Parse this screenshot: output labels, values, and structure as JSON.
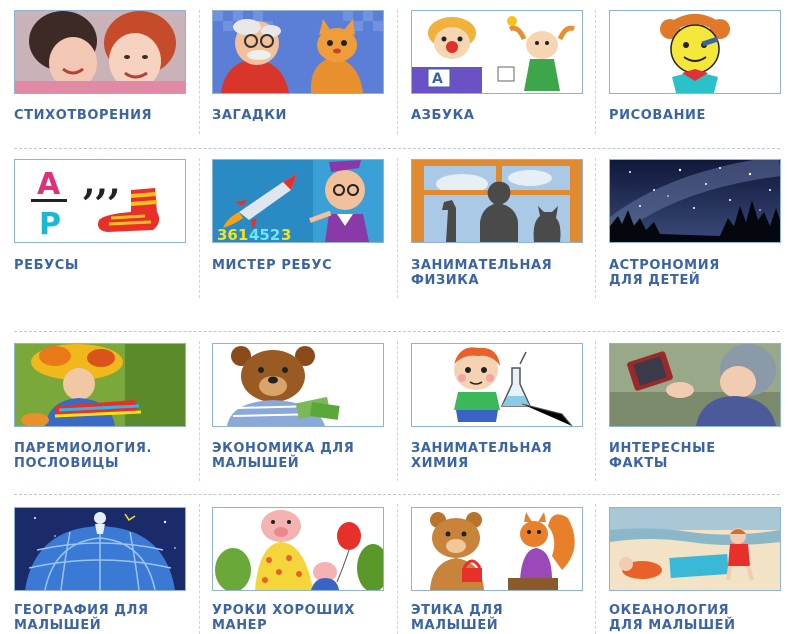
{
  "sections": [
    {
      "items": [
        {
          "id": "poems",
          "label": "СТИХОТВОРЕНИЯ",
          "icon": "children-photo-icon"
        },
        {
          "id": "riddles",
          "label": "ЗАГАДКИ",
          "icon": "grandpa-cat-icon"
        },
        {
          "id": "alphabet",
          "label": "АЗБУКА",
          "icon": "clown-alphabet-icon"
        },
        {
          "id": "drawing",
          "label": "РИСОВАНИЕ",
          "icon": "doll-drawing-icon"
        }
      ]
    },
    {
      "items": [
        {
          "id": "rebuses",
          "label": "РЕБУСЫ",
          "icon": "rebus-letters-sock-icon"
        },
        {
          "id": "mister-rebus",
          "label": "МИСТЕР РЕБУС",
          "icon": "rocket-teacher-icon"
        },
        {
          "id": "physics",
          "label": "ЗАНИМАТЕЛЬНАЯ\nФИЗИКА",
          "icon": "window-silhouettes-icon"
        },
        {
          "id": "astronomy",
          "label": "АСТРОНОМИЯ\nДЛЯ ДЕТЕЙ",
          "icon": "night-sky-icon"
        }
      ]
    },
    {
      "items": [
        {
          "id": "proverbs",
          "label": "ПАРЕМИОЛОГИЯ.\nПОСЛОВИЦЫ",
          "icon": "autumn-leaves-child-icon"
        },
        {
          "id": "economics",
          "label": "ЭКОНОМИКА ДЛЯ\nМАЛЫШЕЙ",
          "icon": "bear-money-icon"
        },
        {
          "id": "chemistry",
          "label": "ЗАНИМАТЕЛЬНАЯ\nХИМИЯ",
          "icon": "boy-flask-icon"
        },
        {
          "id": "facts",
          "label": "ИНТЕРЕСНЫЕ\nФАКТЫ",
          "icon": "child-tablet-icon"
        }
      ]
    },
    {
      "items": [
        {
          "id": "geography",
          "label": "ГЕОГРАФИЯ ДЛЯ\nМАЛЫШЕЙ",
          "icon": "globe-night-icon"
        },
        {
          "id": "manners",
          "label": "УРОКИ ХОРОШИХ\nМАНЕР",
          "icon": "pig-balloon-icon"
        },
        {
          "id": "ethics",
          "label": "ЭТИКА ДЛЯ\nМАЛЫШЕЙ",
          "icon": "bear-squirrel-icon"
        },
        {
          "id": "oceanology",
          "label": "ОКЕАНОЛОГИЯ\nДЛЯ МАЛЫШЕЙ",
          "icon": "beach-children-icon"
        }
      ]
    }
  ]
}
